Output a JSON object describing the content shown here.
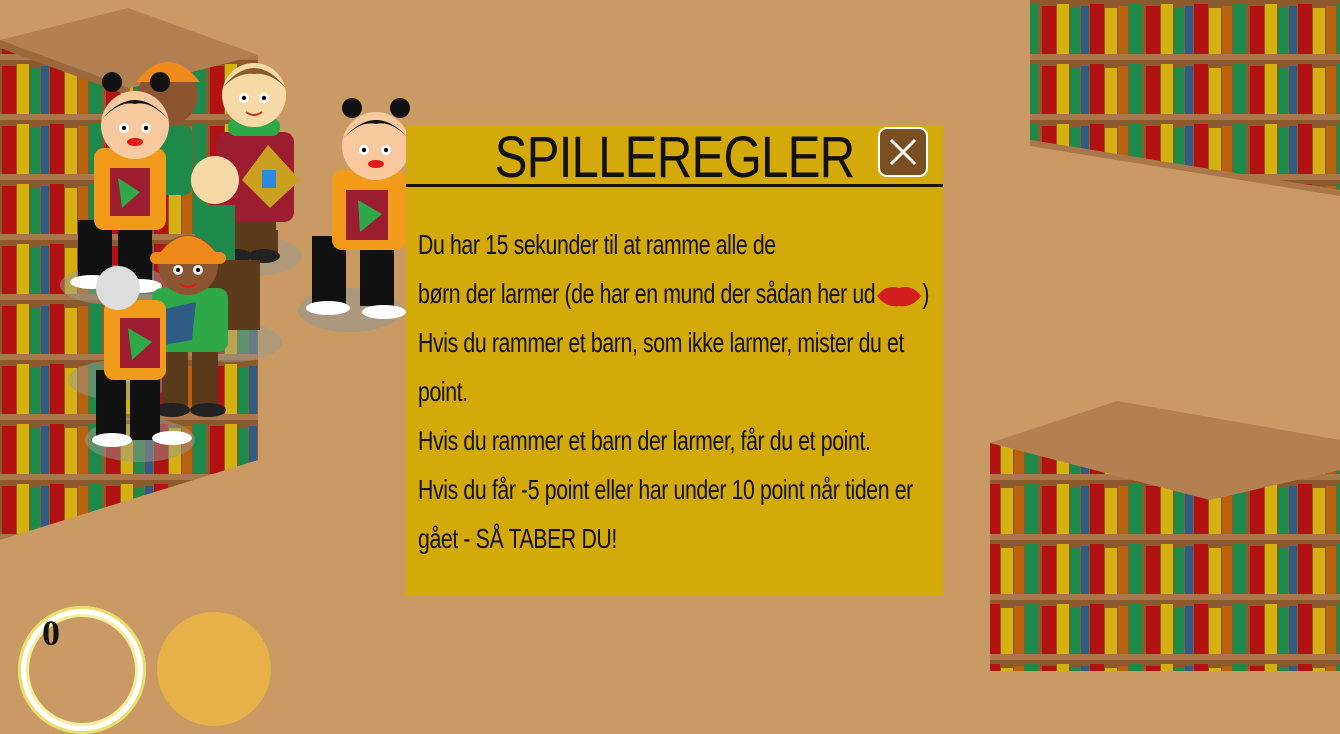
{
  "modal": {
    "title": "SPILLEREGLER",
    "close_label": "close",
    "rules": [
      "Du har 15 sekunder til at ramme alle de",
      "børn der larmer (de har en mund der sådan her ud",
      "Hvis du rammer et barn, som ikke larmer, mister du et",
      "point.",
      "Hvis du rammer et barn der larmer, får du et point.",
      "Hvis du får -5 point eller har under 10 point når tiden er",
      "gået - SÅ TABER DU!"
    ],
    "rule_suffix": ")"
  },
  "hud": {
    "score": "0"
  },
  "colors": {
    "background": "#c99a64",
    "modal": "#d4a90a",
    "close_button": "#7a4f22",
    "lips": "#d31f1f",
    "timer": "#e8b048"
  },
  "icons": {
    "close": "close-icon",
    "lips": "lips-icon"
  }
}
